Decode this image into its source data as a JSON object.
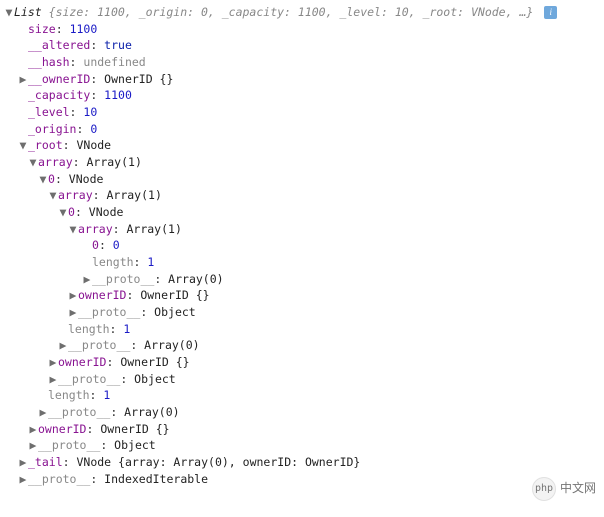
{
  "header": {
    "type": "List",
    "summary": "{size: 1100, _origin: 0, _capacity: 1100, _level: 10, _root: VNode, …}"
  },
  "top": {
    "size_k": "size",
    "size_v": 1100,
    "altered_k": "__altered",
    "altered_v": "true",
    "hash_k": "__hash",
    "hash_v": "undefined",
    "ownerID_k": "__ownerID",
    "ownerID_v": "OwnerID {}",
    "capacity_k": "_capacity",
    "capacity_v": 1100,
    "level_k": "_level",
    "level_v": 10,
    "origin_k": "_origin",
    "origin_v": 0,
    "root_k": "_root",
    "root_v": "VNode"
  },
  "r1": {
    "array_k": "array",
    "array_v": "Array(1)",
    "idx_k": "0",
    "idx_v": "VNode"
  },
  "r2": {
    "array_k": "array",
    "array_v": "Array(1)",
    "idx_k": "0",
    "idx_v": "VNode"
  },
  "r3": {
    "array_k": "array",
    "array_v": "Array(1)",
    "idx0_k": "0",
    "idx0_v": 0,
    "len_k": "length",
    "len_v": 1,
    "proto_k": "__proto__",
    "proto_v": "Array(0)"
  },
  "vnode_inner": {
    "owner_k": "ownerID",
    "owner_v": "OwnerID {}",
    "proto_k": "__proto__",
    "proto_v": "Object",
    "len_k": "length",
    "len_v": 1,
    "aproto_k": "__proto__",
    "aproto_v": "Array(0)"
  },
  "vnode_mid": {
    "owner_k": "ownerID",
    "owner_v": "OwnerID {}",
    "proto_k": "__proto__",
    "proto_v": "Object",
    "len_k": "length",
    "len_v": 1,
    "aproto_k": "__proto__",
    "aproto_v": "Array(0)"
  },
  "vnode_outer": {
    "owner_k": "ownerID",
    "owner_v": "OwnerID {}",
    "proto_k": "__proto__",
    "proto_v": "Object"
  },
  "tail": {
    "k": "_tail",
    "v": "VNode {array: Array(0), ownerID: OwnerID}"
  },
  "proto_final": {
    "k": "__proto__",
    "v": "IndexedIterable"
  },
  "watermark": {
    "logo": "php",
    "text": "中文网"
  }
}
